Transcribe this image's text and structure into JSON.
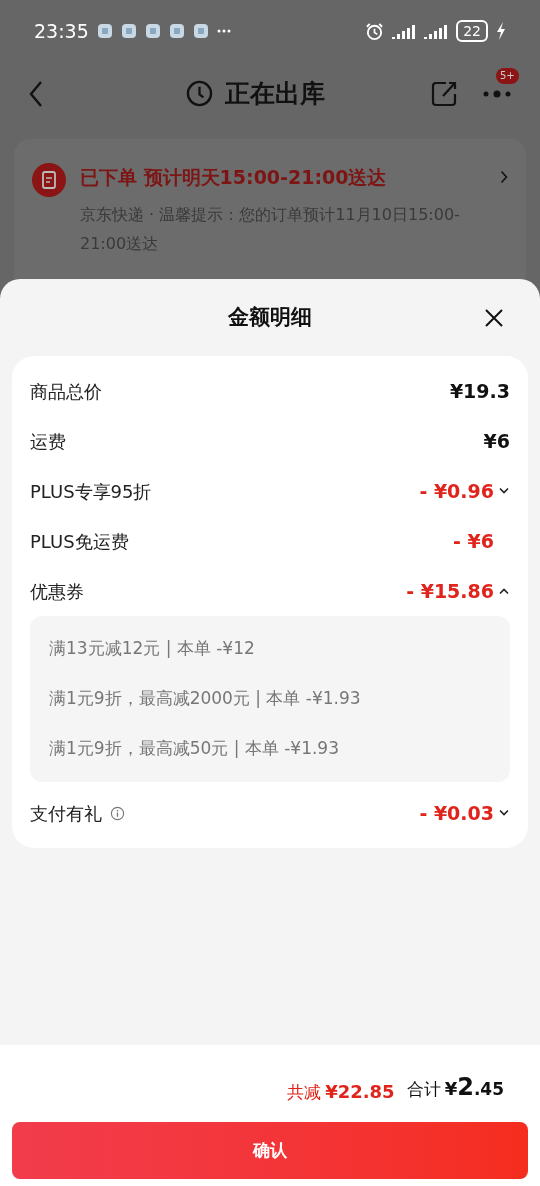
{
  "status_bar": {
    "time": "23:35",
    "battery": "22"
  },
  "header": {
    "title": "正在出库",
    "badge": "5+"
  },
  "order_card": {
    "status": "已下单 预计明天15:00-21:00送达",
    "note": "京东快递 · 温馨提示：您的订单预计11月10日15:00-21:00送达"
  },
  "sheet": {
    "title": "金额明细",
    "rows": [
      {
        "kind": "plain",
        "label": "商品总价",
        "amount": "¥19.3"
      },
      {
        "kind": "plain",
        "label": "运费",
        "amount": "¥6"
      },
      {
        "kind": "discount",
        "label": "PLUS专享95折",
        "amount": "- ¥0.96",
        "expanded": false
      },
      {
        "kind": "discount",
        "label": "PLUS免运费",
        "amount": "- ¥6"
      },
      {
        "kind": "discount",
        "label": "优惠券",
        "amount": "- ¥15.86",
        "expanded": true,
        "details": [
          "满13元减12元 | 本单 -¥12",
          "满1元9折，最高减2000元 | 本单 -¥1.93",
          "满1元9折，最高减50元 | 本单 -¥1.93"
        ]
      },
      {
        "kind": "discount",
        "label": "支付有礼",
        "amount": "- ¥0.03",
        "expanded": false,
        "info": true
      }
    ]
  },
  "footer": {
    "saved_label": "共减",
    "saved": "¥22.85",
    "total_label": "合计",
    "total_currency": "¥",
    "total_integer": "2",
    "total_decimal": ".45",
    "confirm": "确认"
  }
}
